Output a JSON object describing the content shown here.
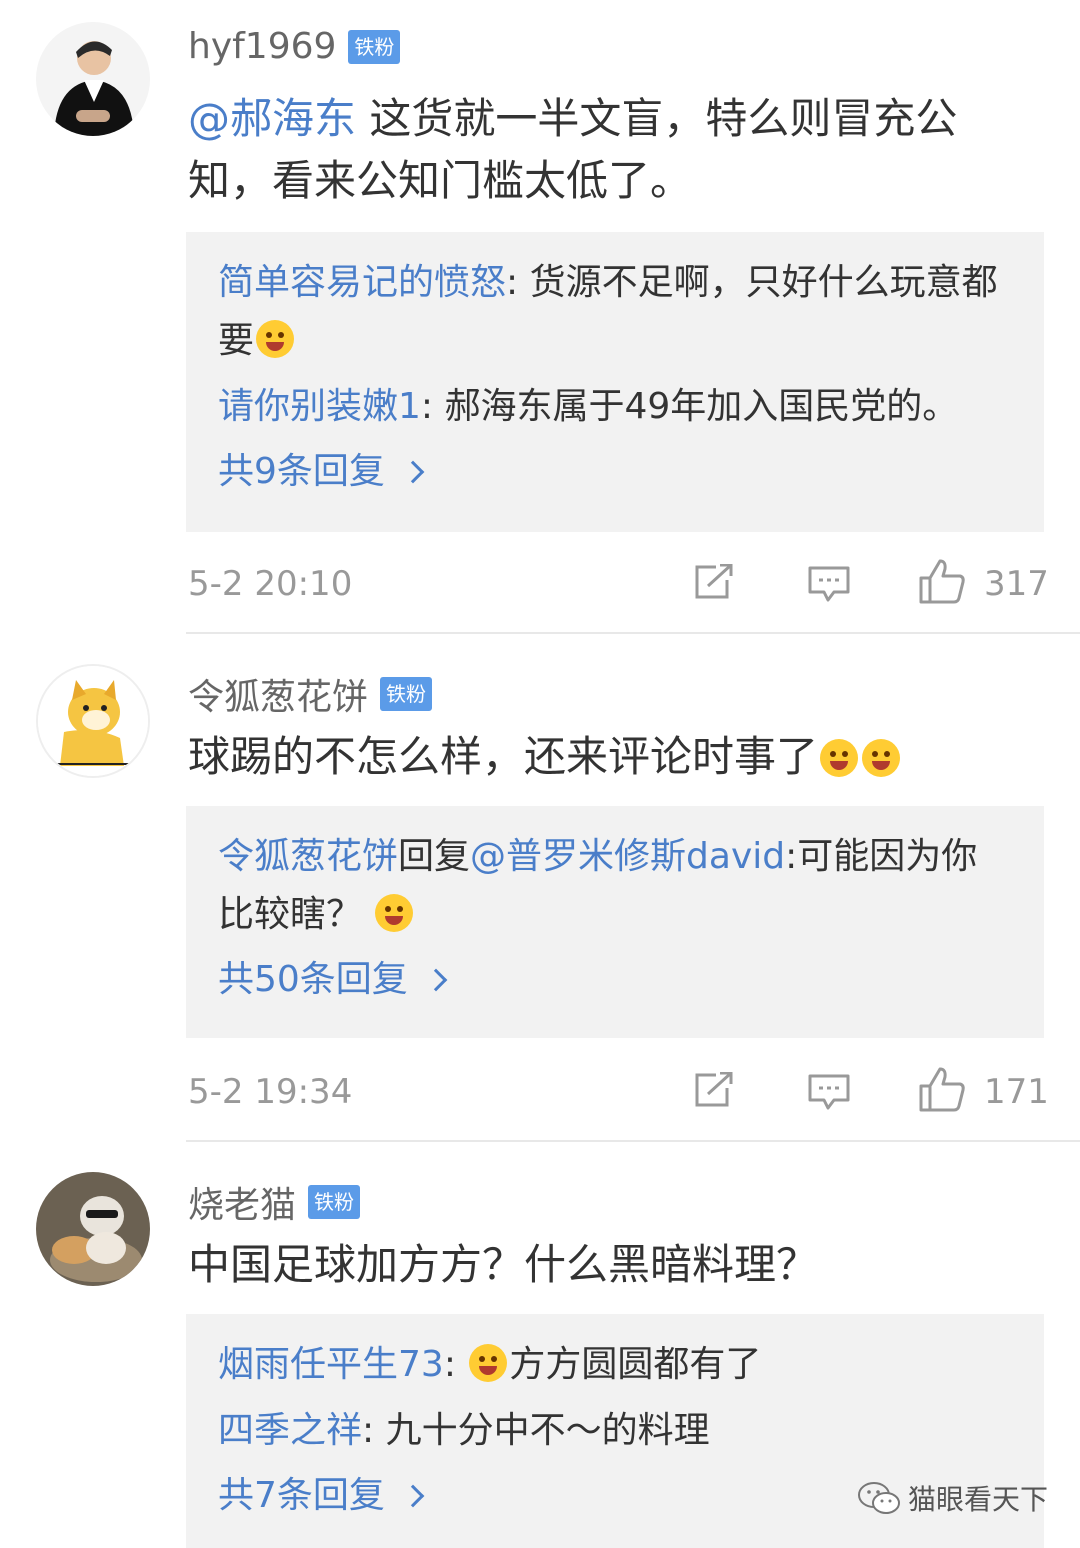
{
  "comments": [
    {
      "username": "hyf1969",
      "badge": "铁粉",
      "mention": "@郝海东",
      "text": " 这货就一半文盲，特么则冒充公知，看来公知门槛太低了。",
      "replies": [
        {
          "name": "简单容易记的愤怒",
          "sep": ": ",
          "text": "货源不足啊，只好什么玩意都要"
        },
        {
          "name": "请你别装嫩1",
          "sep": ": ",
          "text": "郝海东属于49年加入国民党的。"
        }
      ],
      "more": "共9条回复",
      "time": "5-2 20:10",
      "likes": "317"
    },
    {
      "username": "令狐葱花饼",
      "badge": "铁粉",
      "text": "球踢的不怎么样，还来评论时事了",
      "replies": [
        {
          "name": "令狐葱花饼",
          "mid": "回复",
          "mention": "@普罗米修斯david",
          "sep": ":",
          "text": "可能因为你比较瞎？"
        }
      ],
      "more": "共50条回复",
      "time": "5-2 19:34",
      "likes": "171"
    },
    {
      "username": "烧老猫",
      "badge": "铁粉",
      "text": "中国足球加方方？什么黑暗料理？",
      "replies": [
        {
          "name": "烟雨任平生73",
          "sep": ": ",
          "text": "方方圆圆都有了"
        },
        {
          "name": "四季之祥",
          "sep": ": ",
          "text": "九十分中不～的料理"
        }
      ],
      "more": "共7条回复"
    }
  ],
  "watermark": "猫眼看天下",
  "colors": {
    "link": "#4a7ec9",
    "badge": "#5b9be8",
    "reply_bg": "#f2f2f2",
    "meta": "#999999"
  }
}
